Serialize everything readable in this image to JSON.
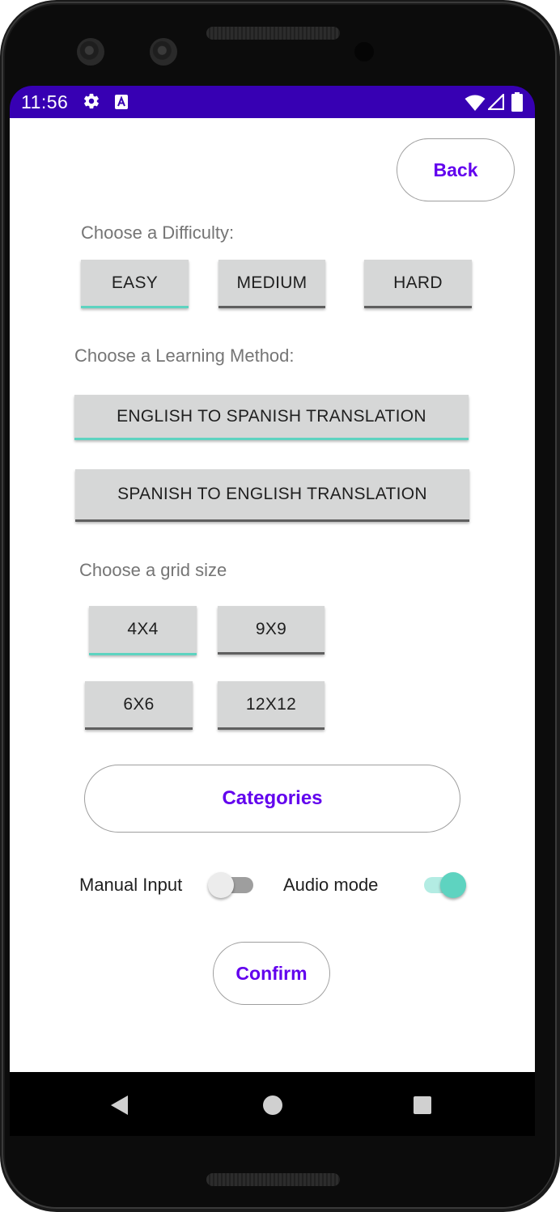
{
  "status_bar": {
    "time": "11:56",
    "icons": [
      "gear-icon",
      "text-a-icon",
      "wifi-icon",
      "signal-icon",
      "battery-icon"
    ],
    "color": "#3700b3"
  },
  "top": {
    "back_label": "Back"
  },
  "difficulty": {
    "label": "Choose a Difficulty:",
    "options": [
      {
        "label": "EASY",
        "selected": true
      },
      {
        "label": "MEDIUM",
        "selected": false
      },
      {
        "label": "HARD",
        "selected": false
      }
    ]
  },
  "method": {
    "label": "Choose a Learning Method:",
    "options": [
      {
        "label": "ENGLISH TO SPANISH TRANSLATION",
        "selected": true
      },
      {
        "label": "SPANISH TO ENGLISH TRANSLATION",
        "selected": false
      }
    ]
  },
  "grid": {
    "label": "Choose a grid size",
    "options": [
      {
        "label": "4X4",
        "selected": true
      },
      {
        "label": "9X9",
        "selected": false
      },
      {
        "label": "6X6",
        "selected": false
      },
      {
        "label": "12X12",
        "selected": false
      }
    ]
  },
  "categories_label": "Categories",
  "toggles": {
    "manual_input": {
      "label": "Manual Input",
      "on": false
    },
    "audio_mode": {
      "label": "Audio mode",
      "on": true
    }
  },
  "confirm_label": "Confirm",
  "colors": {
    "accent": "#6200ee",
    "selected_indicator": "#5ed3c0",
    "button_bg": "#d6d7d7"
  },
  "nav": {
    "icons": [
      "back-triangle-icon",
      "home-circle-icon",
      "recents-square-icon"
    ]
  }
}
